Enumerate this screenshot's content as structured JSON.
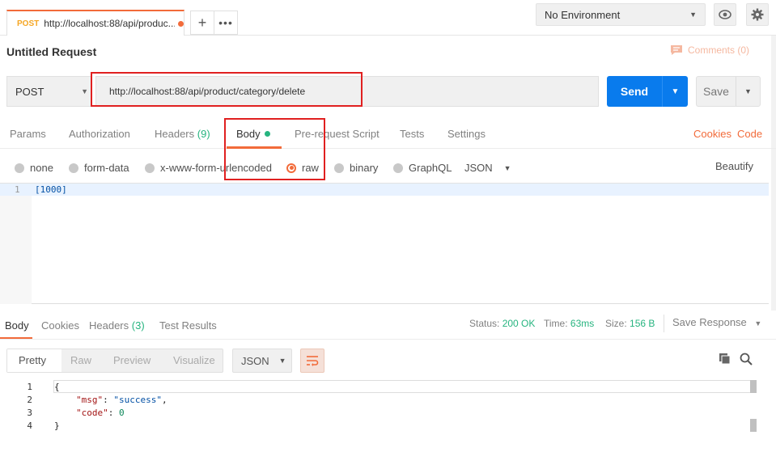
{
  "tab": {
    "method": "POST",
    "title": "http://localhost:88/api/produc..."
  },
  "environment": {
    "selected": "No Environment"
  },
  "request": {
    "title": "Untitled Request",
    "comments": "Comments (0)",
    "method": "POST",
    "url": "http://localhost:88/api/product/category/delete",
    "send_label": "Send",
    "save_label": "Save"
  },
  "request_tabs": {
    "params": "Params",
    "authorization": "Authorization",
    "headers": "Headers",
    "headers_count": "(9)",
    "body": "Body",
    "prerequest": "Pre-request Script",
    "tests": "Tests",
    "settings": "Settings",
    "cookies": "Cookies",
    "code": "Code"
  },
  "body_types": {
    "none": "none",
    "form_data": "form-data",
    "urlencoded": "x-www-form-urlencoded",
    "raw": "raw",
    "binary": "binary",
    "graphql": "GraphQL",
    "format": "JSON",
    "beautify": "Beautify"
  },
  "request_body": {
    "line1_num": "1",
    "line1": "[1000]"
  },
  "response_tabs": {
    "body": "Body",
    "cookies": "Cookies",
    "headers": "Headers",
    "headers_count": "(3)",
    "test_results": "Test Results"
  },
  "response_meta": {
    "status_label": "Status:",
    "status": "200 OK",
    "time_label": "Time:",
    "time": "63ms",
    "size_label": "Size:",
    "size": "156 B",
    "save_response": "Save Response"
  },
  "view_modes": {
    "pretty": "Pretty",
    "raw": "Raw",
    "preview": "Preview",
    "visualize": "Visualize",
    "format": "JSON"
  },
  "response_body": {
    "lines": [
      "1",
      "2",
      "3",
      "4"
    ],
    "open": "{",
    "msg_key": "\"msg\"",
    "msg_val": "\"success\"",
    "code_key": "\"code\"",
    "code_val": "0",
    "close": "}"
  }
}
